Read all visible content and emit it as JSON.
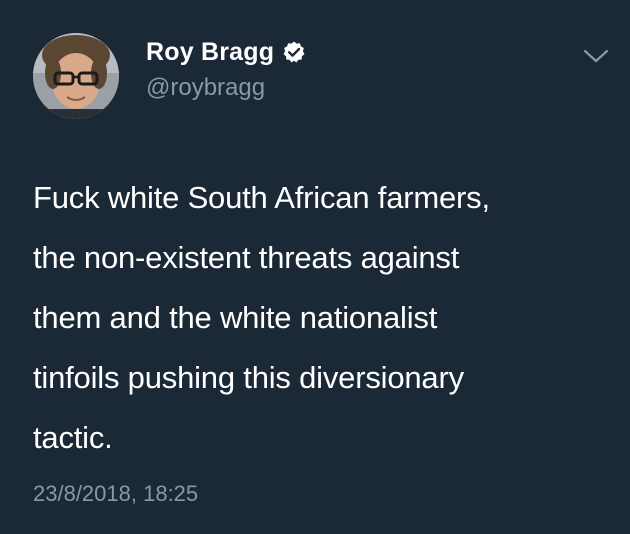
{
  "tweet": {
    "display_name": "Roy Bragg",
    "handle": "@roybragg",
    "text_lines": [
      "Fuck white South African farmers,",
      "the non-existent threats against",
      "them and the white nationalist",
      "tinfoils pushing this diversionary",
      "tactic."
    ],
    "timestamp": "23/8/2018, 18:25"
  },
  "icons": {
    "verified": "verified-badge-icon",
    "menu": "chevron-down-icon"
  },
  "colors": {
    "background": "#1b2836",
    "text_primary": "#ffffff",
    "text_secondary": "#8899a6"
  }
}
